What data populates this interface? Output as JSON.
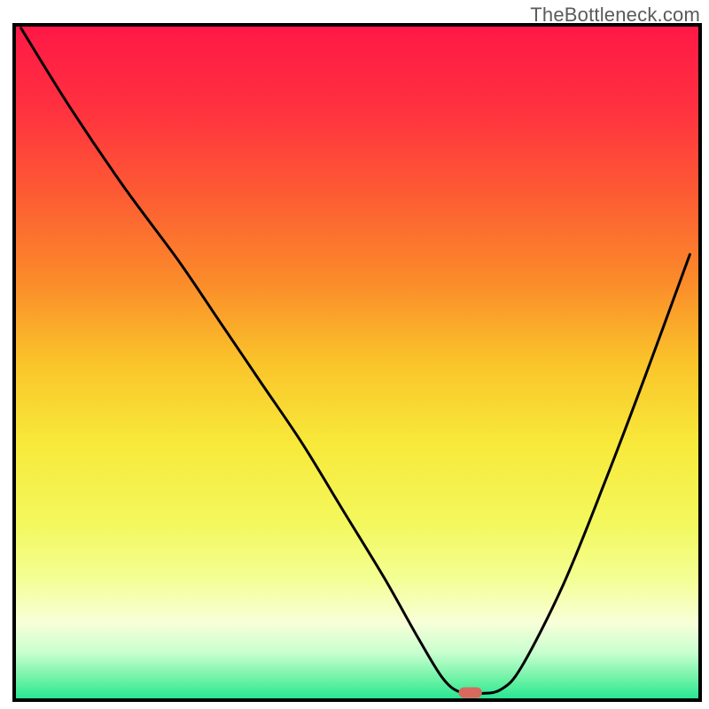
{
  "watermark": "TheBottleneck.com",
  "chart_data": {
    "type": "line",
    "title": "",
    "xlabel": "",
    "ylabel": "",
    "xlim": [
      0,
      100
    ],
    "ylim": [
      0,
      100
    ],
    "notes": "Axes have no tick labels – values are relative percentages of plot area. Curve is a V-shaped bottleneck profile on a vertical red→green gradient background.",
    "gradient_stops": [
      {
        "offset": 0.0,
        "color": "#ff1846"
      },
      {
        "offset": 0.12,
        "color": "#ff3040"
      },
      {
        "offset": 0.25,
        "color": "#fd5b33"
      },
      {
        "offset": 0.38,
        "color": "#fb8b2a"
      },
      {
        "offset": 0.5,
        "color": "#fac42a"
      },
      {
        "offset": 0.62,
        "color": "#f8e93a"
      },
      {
        "offset": 0.74,
        "color": "#f3f85e"
      },
      {
        "offset": 0.82,
        "color": "#f4ff94"
      },
      {
        "offset": 0.885,
        "color": "#f8ffd8"
      },
      {
        "offset": 0.93,
        "color": "#c8ffcf"
      },
      {
        "offset": 0.97,
        "color": "#6af2a4"
      },
      {
        "offset": 1.0,
        "color": "#22e591"
      }
    ],
    "series": [
      {
        "name": "bottleneck-curve",
        "color": "#000000",
        "x": [
          1,
          8,
          16,
          24,
          30,
          36,
          42,
          48,
          54,
          59,
          62.5,
          65,
          68,
          71,
          74,
          80,
          86,
          92,
          98.5
        ],
        "y": [
          99.5,
          88,
          76,
          65,
          56,
          47,
          38,
          28,
          18,
          9,
          3.2,
          1.2,
          1.0,
          1.6,
          5,
          17,
          32,
          48,
          66
        ]
      }
    ],
    "marker": {
      "name": "minimum-pill",
      "x": 66.5,
      "y": 1.1,
      "width": 3.4,
      "height": 1.6,
      "color": "#d8695f"
    }
  }
}
